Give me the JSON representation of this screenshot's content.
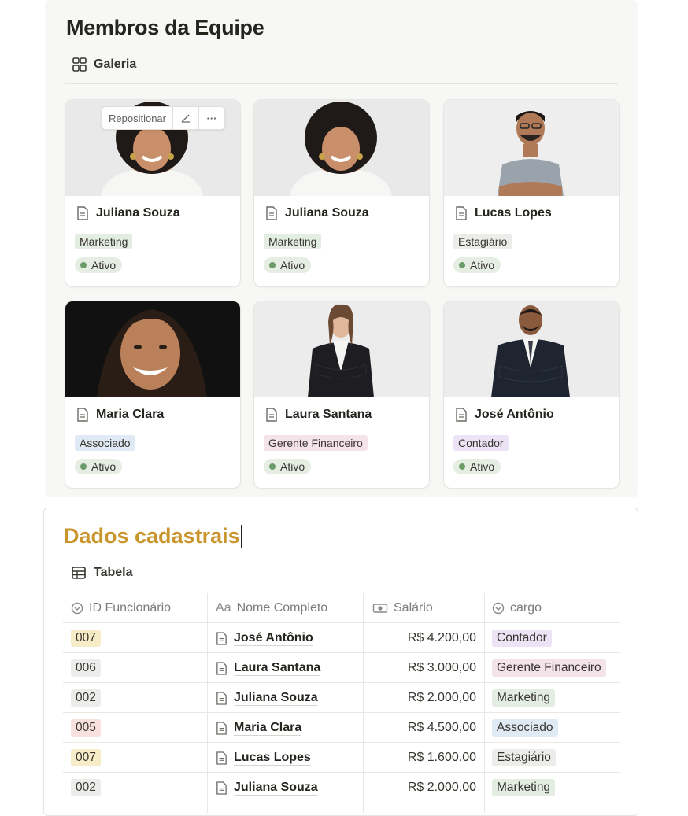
{
  "gallery": {
    "title": "Membros da Equipe",
    "view_label": "Galeria",
    "hover_toolbar": {
      "reposition_label": "Repositionar",
      "edit_icon": "pencil-icon",
      "more_icon": "ellipsis-icon",
      "more_label": "···"
    },
    "cards": [
      {
        "name": "Juliana Souza",
        "role": "Marketing",
        "status": "Ativo"
      },
      {
        "name": "Juliana Souza",
        "role": "Marketing",
        "status": "Ativo"
      },
      {
        "name": "Lucas Lopes",
        "role": "Estagiário",
        "status": "Ativo"
      },
      {
        "name": "Maria Clara",
        "role": "Associado",
        "status": "Ativo"
      },
      {
        "name": "Laura Santana",
        "role": "Gerente Financeiro",
        "status": "Ativo"
      },
      {
        "name": "José Antônio",
        "role": "Contador",
        "status": "Ativo"
      }
    ]
  },
  "table": {
    "title": "Dados cadastrais",
    "view_label": "Tabela",
    "headers": {
      "id": "ID Funcionário",
      "name": "Nome Completo",
      "name_prefix": "Aa",
      "salary": "Salário",
      "cargo": "cargo"
    },
    "rows": [
      {
        "id": "007",
        "name": "José Antônio",
        "salary": "R$ 4.200,00",
        "cargo": "Contador"
      },
      {
        "id": "006",
        "name": "Laura Santana",
        "salary": "R$ 3.000,00",
        "cargo": "Gerente Financeiro"
      },
      {
        "id": "002",
        "name": "Juliana Souza",
        "salary": "R$ 2.000,00",
        "cargo": "Marketing"
      },
      {
        "id": "005",
        "name": "Maria Clara",
        "salary": "R$ 4.500,00",
        "cargo": "Associado"
      },
      {
        "id": "007",
        "name": "Lucas Lopes",
        "salary": "R$ 1.600,00",
        "cargo": "Estagiário"
      },
      {
        "id": "002",
        "name": "Juliana Souza",
        "salary": "R$ 2.000,00",
        "cargo": "Marketing"
      }
    ]
  },
  "colors": {
    "title_accent": "#c9952c",
    "tag_marketing": "#e4ede2",
    "tag_estagiario": "#ececea",
    "tag_associado": "#dfeaf4",
    "tag_gerente": "#f5e3ec",
    "tag_contador": "#ece3f4",
    "status_dot": "#6c9b6a"
  }
}
